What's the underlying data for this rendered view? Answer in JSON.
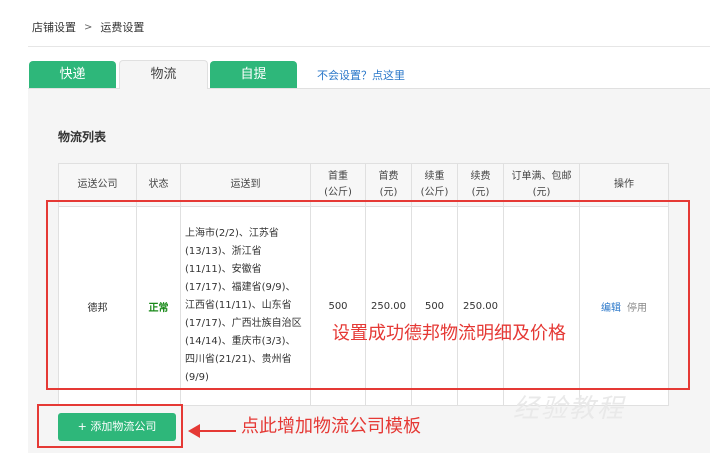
{
  "breadcrumb": {
    "item1": "店铺设置",
    "separator": ">",
    "item2": "运费设置"
  },
  "tabs": [
    {
      "label": "快递"
    },
    {
      "label": "物流"
    },
    {
      "label": "自提"
    }
  ],
  "help_link": "不会设置？点这里",
  "list_title": "物流列表",
  "table": {
    "headers": {
      "company": "运送公司",
      "status": "状态",
      "region": "运送到",
      "first_weight_l1": "首重",
      "first_weight_l2": "(公斤)",
      "first_fee_l1": "首费",
      "first_fee_l2": "(元)",
      "cont_weight_l1": "续重",
      "cont_weight_l2": "(公斤)",
      "cont_fee_l1": "续费",
      "cont_fee_l2": "(元)",
      "free_l1": "订单满、包邮",
      "free_l2": "(元)",
      "action": "操作"
    },
    "row": {
      "company": "德邦",
      "status": "正常",
      "region_lines": [
        "上海市(2/2)、江苏省",
        "(13/13)、浙江省",
        "(11/11)、安徽省",
        "(17/17)、福建省(9/9)、",
        "江西省(11/11)、山东省",
        "(17/17)、广西壮族自治区",
        "(14/14)、重庆市(3/3)、",
        "四川省(21/21)、贵州省",
        "(9/9)"
      ],
      "first_weight": "500",
      "first_fee": "250.00",
      "cont_weight": "500",
      "cont_fee": "250.00",
      "free_threshold": "",
      "edit": "编辑",
      "disable": "停用"
    }
  },
  "annotation1": "设置成功德邦物流明细及价格",
  "annotation2": "点此增加物流公司模板",
  "add_button": "+ 添加物流公司",
  "watermark": "经验教程",
  "colors": {
    "green": "#2eb77a",
    "red": "#e53935",
    "link": "#2a77c9"
  }
}
